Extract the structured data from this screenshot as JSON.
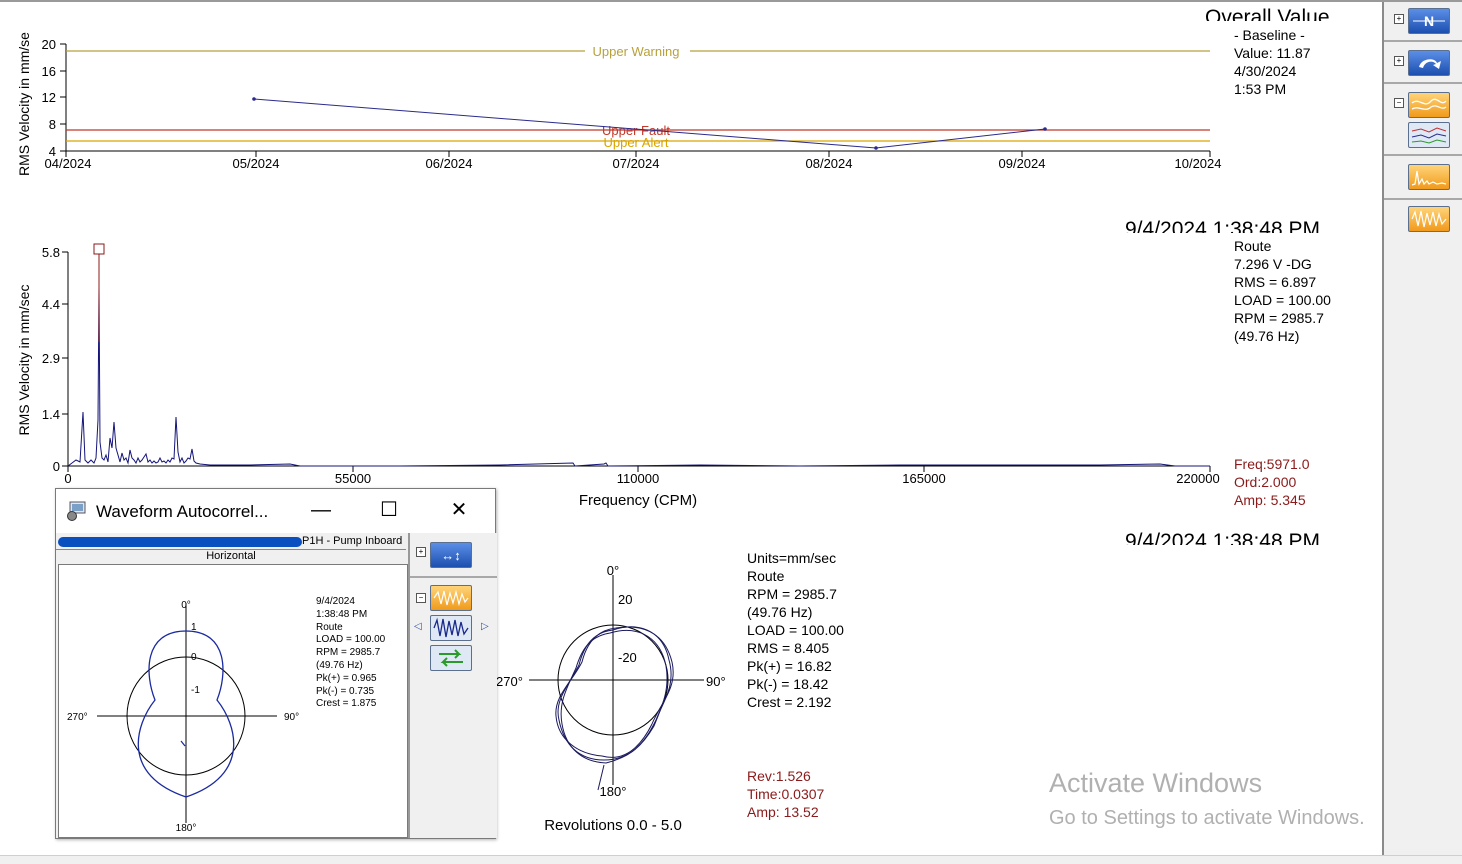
{
  "trend": {
    "ylabel": "RMS Velocity in mm/se",
    "title": "Overall Value",
    "yticks": [
      "20",
      "16",
      "12",
      "8",
      "4"
    ],
    "xticks": [
      "04/2024",
      "05/2024",
      "06/2024",
      "07/2024",
      "08/2024",
      "09/2024",
      "10/2024"
    ],
    "lines": {
      "upper_warning": "Upper Warning",
      "upper_fault": "Upper Fault",
      "upper_alert": "Upper Alert"
    },
    "info": "- Baseline -\nValue: 11.87\n4/30/2024\n1:53 PM"
  },
  "spectrum": {
    "date": "9/4/2024 1:38:48 PM",
    "ylabel": "RMS Velocity in mm/sec",
    "xlabel": "Frequency (CPM)",
    "yticks": [
      "5.8",
      "4.4",
      "2.9",
      "1.4",
      "0"
    ],
    "xticks": [
      "0",
      "55000",
      "110000",
      "165000",
      "220000"
    ],
    "info": "Route\n7.296 V -DG\nRMS = 6.897\nLOAD = 100.00\nRPM = 2985.7\n(49.76 Hz)",
    "cursor": "Freq:5971.0\nOrd:2.000\nAmp: 5.345"
  },
  "orbit": {
    "date": "9/4/2024 1:38:48 PM",
    "labels": {
      "top": "0°",
      "bottom": "180°",
      "left": "270°",
      "right": "90°",
      "r1": "20",
      "r2": "-20"
    },
    "caption": "Revolutions 0.0 - 5.0",
    "info": "Units=mm/sec\nRoute\nRPM = 2985.7\n(49.76 Hz)\nLOAD = 100.00\nRMS = 8.405\nPk(+) = 16.82\nPk(-) = 18.42\nCrest = 2.192",
    "cursor": "Rev:1.526\nTime:0.0307\nAmp: 13.52"
  },
  "popup": {
    "title": "Waveform Autocorrel...",
    "minimize": "—",
    "maximize": "☐",
    "close": "✕",
    "point": "P1H - Pump Inboard",
    "direction": "Horizontal",
    "labels": {
      "top": "0°",
      "bottom": "180°",
      "left": "270°",
      "right": "90°",
      "r1": "1",
      "r2": "0",
      "r3": "-1"
    },
    "info": "9/4/2024\n1:38:48 PM\nRoute\nLOAD = 100.00\nRPM = 2985.7\n(49.76 Hz)\nPk(+) = 0.965\nPk(-) = 0.735\nCrest = 1.875"
  },
  "watermark": {
    "line1": "Activate Windows",
    "line2": "Go to Settings to activate Windows."
  },
  "sidebar": {
    "expand": "+",
    "collapse": "−",
    "first_icon_letter": "N"
  },
  "colors": {
    "trend_line": "#2a2a8c",
    "warning": "#b8a13a",
    "fault": "#c0392b",
    "alert": "#d9a400",
    "spectrum": "#14147a",
    "cursor_text": "#8b1a1a"
  }
}
